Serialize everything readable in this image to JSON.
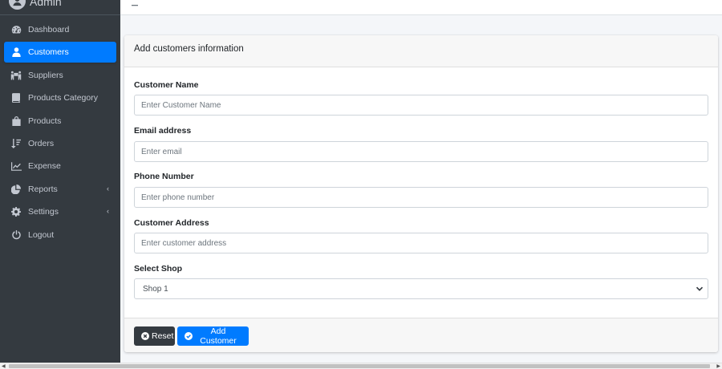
{
  "brand": {
    "name": "Admin"
  },
  "sidebar": {
    "items": [
      {
        "label": "Dashboard",
        "icon": "dashboard-icon",
        "active": false,
        "has_arrow": false
      },
      {
        "label": "Customers",
        "icon": "user-icon",
        "active": true,
        "has_arrow": false
      },
      {
        "label": "Suppliers",
        "icon": "people-carry-icon",
        "active": false,
        "has_arrow": false
      },
      {
        "label": "Products Category",
        "icon": "book-icon",
        "active": false,
        "has_arrow": false
      },
      {
        "label": "Products",
        "icon": "shopping-bag-icon",
        "active": false,
        "has_arrow": false
      },
      {
        "label": "Orders",
        "icon": "sort-amount-icon",
        "active": false,
        "has_arrow": false
      },
      {
        "label": "Expense",
        "icon": "line-chart-icon",
        "active": false,
        "has_arrow": false
      },
      {
        "label": "Reports",
        "icon": "pie-chart-icon",
        "active": false,
        "has_arrow": true
      },
      {
        "label": "Settings",
        "icon": "gear-icon",
        "active": false,
        "has_arrow": true
      },
      {
        "label": "Logout",
        "icon": "power-icon",
        "active": false,
        "has_arrow": false
      }
    ],
    "arrow_glyph": "‹"
  },
  "topbar": {
    "menu_icon": "hamburger-icon"
  },
  "form": {
    "title": "Add customers information",
    "customer_name": {
      "label": "Customer Name",
      "placeholder": "Enter Customer Name",
      "value": ""
    },
    "email": {
      "label": "Email address",
      "placeholder": "Enter email",
      "value": ""
    },
    "phone": {
      "label": "Phone Number",
      "placeholder": "Enter phone number",
      "value": ""
    },
    "address": {
      "label": "Customer Address",
      "placeholder": "Enter customer address",
      "value": ""
    },
    "shop": {
      "label": "Select Shop",
      "selected": "Shop 1"
    }
  },
  "footer": {
    "reset_label": "Reset",
    "add_label": "Add Customer"
  },
  "colors": {
    "sidebar_bg": "#343a40",
    "active": "#007bff",
    "dark_button": "#343a40",
    "primary_button": "#007bff"
  }
}
